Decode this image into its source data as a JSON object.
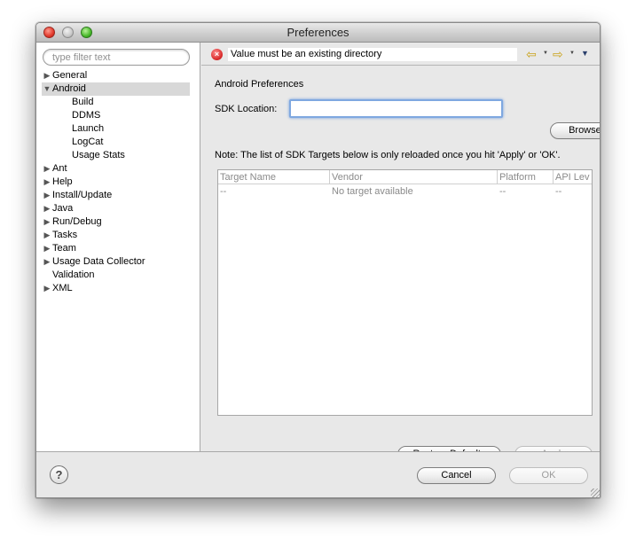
{
  "window": {
    "title": "Preferences"
  },
  "filter": {
    "placeholder": "type filter text",
    "value": ""
  },
  "tree": [
    {
      "label": "General",
      "toggle": "▶"
    },
    {
      "label": "Android",
      "toggle": "▼",
      "selected": true
    },
    {
      "label": "Build",
      "child": true
    },
    {
      "label": "DDMS",
      "child": true
    },
    {
      "label": "Launch",
      "child": true
    },
    {
      "label": "LogCat",
      "child": true
    },
    {
      "label": "Usage Stats",
      "child": true
    },
    {
      "label": "Ant",
      "toggle": "▶"
    },
    {
      "label": "Help",
      "toggle": "▶"
    },
    {
      "label": "Install/Update",
      "toggle": "▶"
    },
    {
      "label": "Java",
      "toggle": "▶"
    },
    {
      "label": "Run/Debug",
      "toggle": "▶"
    },
    {
      "label": "Tasks",
      "toggle": "▶"
    },
    {
      "label": "Team",
      "toggle": "▶"
    },
    {
      "label": "Usage Data Collector",
      "toggle": "▶"
    },
    {
      "label": "Validation",
      "toggle": ""
    },
    {
      "label": "XML",
      "toggle": "▶"
    }
  ],
  "message": {
    "text": "Value must be an existing directory",
    "icon": "error-icon"
  },
  "page": {
    "title": "Android Preferences",
    "sdk_label": "SDK Location:",
    "sdk_value": "",
    "browse_label": "Browse...",
    "note": "Note: The list of SDK Targets below is only reloaded once you hit 'Apply' or 'OK'."
  },
  "table": {
    "headers": [
      "Target Name",
      "Vendor",
      "Platform",
      "API Lev"
    ],
    "rows": [
      [
        "--",
        "No target available",
        "--",
        "--"
      ]
    ]
  },
  "buttons": {
    "restore_defaults": "Restore Defaults",
    "apply": "Apply",
    "cancel": "Cancel",
    "ok": "OK",
    "help": "?"
  },
  "colors": {
    "accent_focus": "#7fa8e0",
    "error": "#d92b2b",
    "nav_arrow": "#c9a21a"
  }
}
